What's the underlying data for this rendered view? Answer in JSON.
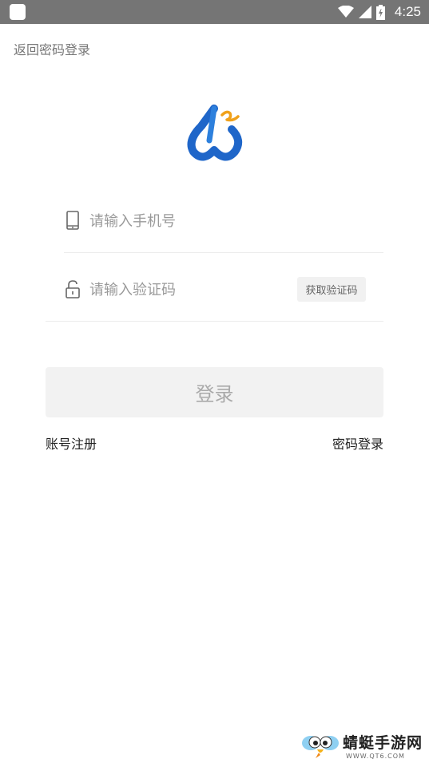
{
  "status_bar": {
    "time": "4:25"
  },
  "header": {
    "back_label": "返回密码登录"
  },
  "form": {
    "phone_placeholder": "请输入手机号",
    "code_placeholder": "请输入验证码",
    "get_code_label": "获取验证码",
    "login_label": "登录"
  },
  "links": {
    "register": "账号注册",
    "password_login": "密码登录"
  },
  "watermark": {
    "title": "蜻蜓手游网",
    "url": "WWW.QT6.COM"
  },
  "colors": {
    "status_bar": "#757575",
    "logo_blue": "#1f66c9",
    "logo_orange": "#f0a11a",
    "button_bg": "#f2f2f2"
  },
  "icons": [
    "phone-icon",
    "lock-icon",
    "wifi-icon",
    "signal-icon",
    "battery-icon",
    "app-logo",
    "dragonfly-icon"
  ]
}
